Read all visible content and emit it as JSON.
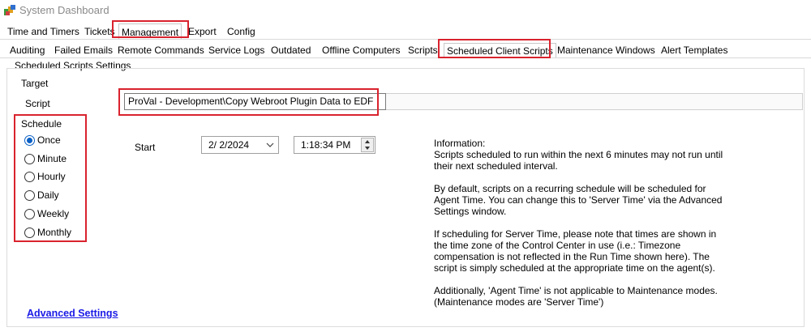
{
  "window": {
    "title": "System Dashboard",
    "icon": "dashboard-app-icon"
  },
  "menu_tabs": [
    {
      "label": "Time and Timers",
      "active": false
    },
    {
      "label": "Tickets",
      "active": false
    },
    {
      "label": "Management",
      "active": true
    },
    {
      "label": "Export",
      "active": false
    },
    {
      "label": "Config",
      "active": false
    }
  ],
  "sub_tabs": [
    {
      "label": "Auditing",
      "active": false
    },
    {
      "label": "Failed Emails",
      "active": false
    },
    {
      "label": "Remote Commands",
      "active": false
    },
    {
      "label": "Service Logs",
      "active": false
    },
    {
      "label": "Outdated",
      "active": false
    },
    {
      "label": "Offline Computers",
      "active": false
    },
    {
      "label": "Scripts",
      "active": false
    },
    {
      "label": "Scheduled Client Scripts",
      "active": true
    },
    {
      "label": "Maintenance Windows",
      "active": false
    },
    {
      "label": "Alert Templates",
      "active": false
    }
  ],
  "settings": {
    "title": "Scheduled Scripts Settings",
    "target_label": "Target",
    "script_label": "Script",
    "script_value": "ProVal - Development\\Copy Webroot Plugin Data to EDF"
  },
  "schedule": {
    "label": "Schedule",
    "options": [
      "Once",
      "Minute",
      "Hourly",
      "Daily",
      "Weekly",
      "Monthly"
    ],
    "selected": "Once",
    "start_label": "Start",
    "date_value": "2/ 2/2024",
    "time_value": "1:18:34 PM"
  },
  "information": {
    "heading": "Information:",
    "lines": [
      "Scripts scheduled to run within the next 6 minutes may not run until",
      "their next scheduled interval.",
      "",
      "By default, scripts on a recurring schedule will be scheduled for",
      "Agent Time. You can change this to 'Server Time' via the Advanced",
      "Settings window.",
      "",
      "If scheduling for Server Time, please note that times are shown in",
      "the time zone of the Control Center in use (i.e.: Timezone",
      "compensation is not reflected in the Run Time shown here). The",
      "script is simply scheduled at the appropriate time on the agent(s).",
      "",
      "Additionally, 'Agent Time' is not applicable to Maintenance modes.",
      "(Maintenance modes are 'Server Time')"
    ]
  },
  "advanced_link": "Advanced Settings",
  "colors": {
    "highlight": "#d9232e",
    "link": "#1a1ae6",
    "radio_accent": "#0a5fc4"
  }
}
